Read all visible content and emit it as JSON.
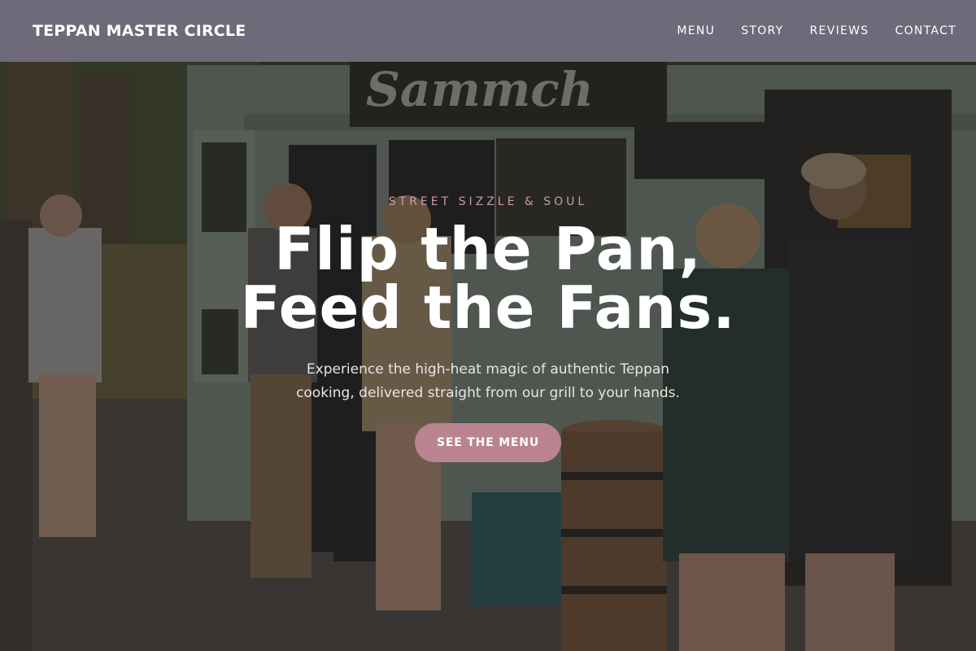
{
  "brand": {
    "name": "TEPPAN MASTER CIRCLE"
  },
  "nav": {
    "links": [
      {
        "label": "MENU"
      },
      {
        "label": "STORY"
      },
      {
        "label": "REVIEWS"
      },
      {
        "label": "CONTACT"
      }
    ]
  },
  "hero": {
    "eyebrow": "STREET SIZZLE & SOUL",
    "headline_line1": "Flip the Pan,",
    "headline_line2": "Feed the Fans.",
    "subtitle": "Experience the high-heat magic of authentic Teppan cooking, delivered straight from our grill to your hands.",
    "cta_label": "SEE THE MENU",
    "background": "food-truck-crowd-photo"
  },
  "colors": {
    "navbar": "#6e6a7a",
    "accent": "#b9838f",
    "eyebrow": "#c89aa6",
    "headline": "#ffffff"
  }
}
